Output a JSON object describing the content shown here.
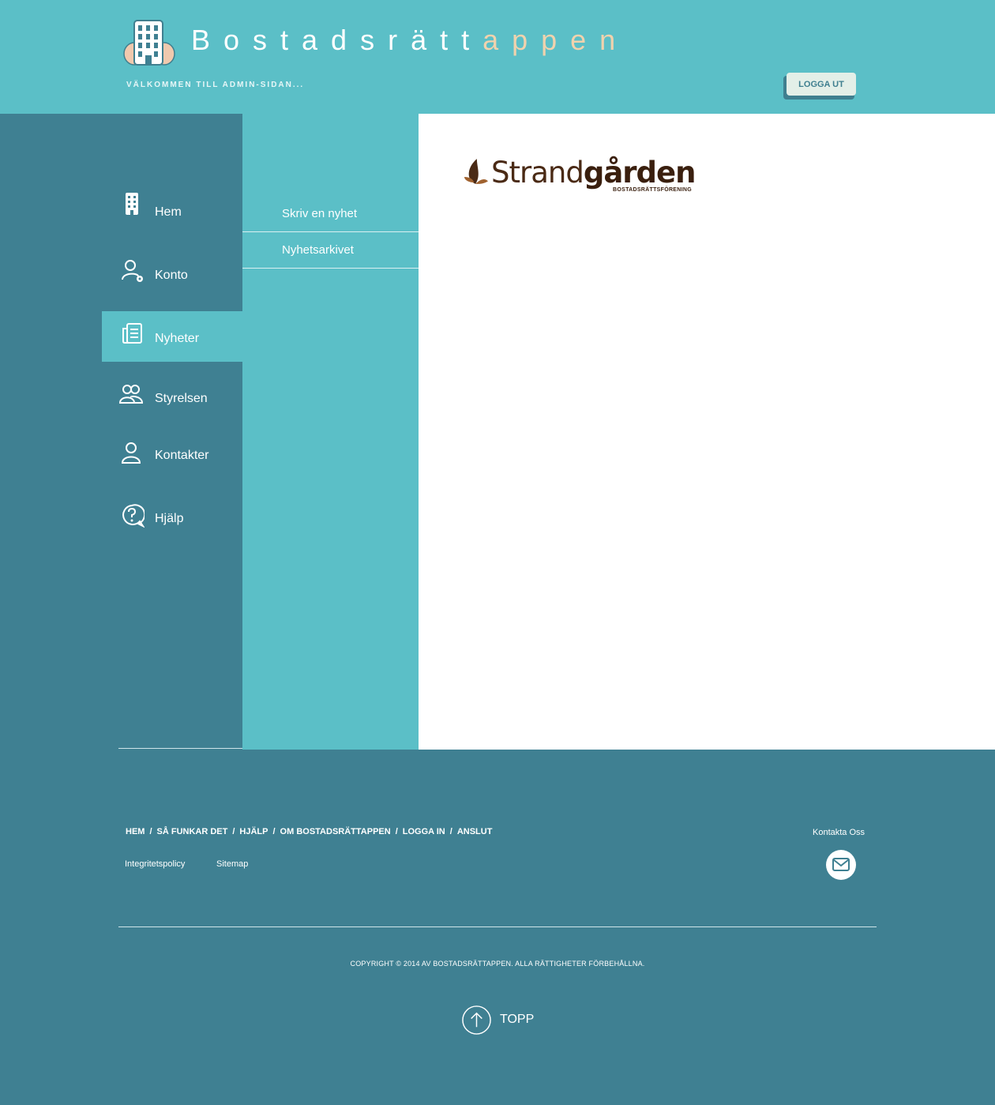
{
  "header": {
    "brand_part1": "Bostadsrätt",
    "brand_part2": "appen",
    "welcome": "VÄLKOMMEN TILL ADMIN-SIDAN...",
    "logout_label": "LOGGA UT"
  },
  "sidebar": {
    "items": [
      {
        "label": "Hem",
        "icon": "building-icon"
      },
      {
        "label": "Konto",
        "icon": "user-settings-icon"
      },
      {
        "label": "Nyheter",
        "icon": "newspaper-icon",
        "active": true
      },
      {
        "label": "Styrelsen",
        "icon": "group-icon"
      },
      {
        "label": "Kontakter",
        "icon": "user-icon"
      },
      {
        "label": "Hjälp",
        "icon": "help-icon"
      }
    ]
  },
  "submenu": {
    "items": [
      {
        "label": "Skriv en nyhet"
      },
      {
        "label": "Nyhetsarkivet"
      }
    ]
  },
  "content": {
    "logo_light": "Strand",
    "logo_bold": "gården",
    "logo_sub": "BOSTADSRÄTTSFÖRENING"
  },
  "footer": {
    "links": [
      "HEM",
      "SÅ FUNKAR DET",
      "HJÄLP",
      "OM BOSTADSRÄTTAPPEN",
      "LOGGA IN",
      "ANSLUT"
    ],
    "separator": "/",
    "privacy": "Integritetspolicy",
    "sitemap": "Sitemap",
    "contact_label": "Kontakta Oss",
    "copyright": "COPYRIGHT © 2014 AV BOSTADSRÄTTAPPEN. ALLA RÄTTIGHETER FÖRBEHÅLLNA.",
    "top_label": "TOPP"
  },
  "colors": {
    "header_bg": "#5bbfc7",
    "sidebar_bg": "#3f8092",
    "accent": "#f0d2ad",
    "logo_brown": "#4a2a15"
  }
}
